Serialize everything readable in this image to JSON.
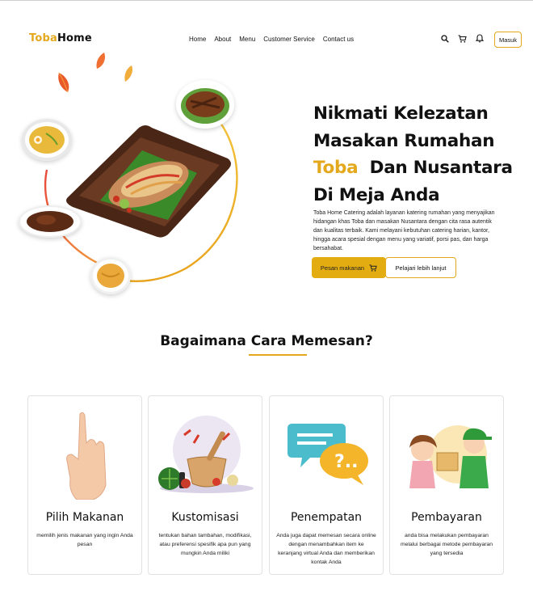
{
  "brand": {
    "part1": "Toba",
    "part2": "Home"
  },
  "nav": {
    "items": [
      "Home",
      "About",
      "Menu",
      "Customer Service",
      "Contact us"
    ]
  },
  "header": {
    "icons": [
      "search-icon",
      "cart-icon",
      "bell-icon"
    ],
    "login_label": "Masuk"
  },
  "hero": {
    "line1": "Nikmati Kelezatan",
    "line2": "Masakan Rumahan",
    "line3_highlight": "Toba",
    "line3_rest": "Dan Nusantara",
    "line4": "Di Meja Anda",
    "description": "Toba Home Catering adalah layanan katering rumahan yang menyajikan hidangan khas Toba dan masakan Nusantara dengan cita rasa autentik dan kualitas terbaik. Kami melayani kebutuhan catering harian, kantor, hingga acara spesial dengan menu yang variatif, porsi pas, dan harga bersahabat.",
    "order_button": "Pesan makanan",
    "learn_button": "Pelajari lebih lanjut"
  },
  "how_to": {
    "title": "Bagaimana Cara Memesan?",
    "steps": [
      {
        "title": "Pilih Makanan",
        "desc": "memilih jenis makanan yang ingin Anda pesan"
      },
      {
        "title": "Kustomisasi",
        "desc": "tentukan bahan tambahan, modifikasi, atau preferensi spesifik apa pun yang mungkin Anda miliki"
      },
      {
        "title": "Penempatan",
        "desc": "Anda juga dapat memesan secara online dengan menambahkan item ke keranjang virtual Anda dan memberikan kontak Anda"
      },
      {
        "title": "Pembayaran",
        "desc": "anda bisa melakukan pembayaran melalui berbagai metode pembayaran yang tersedia"
      }
    ]
  },
  "colors": {
    "accent": "#e3a81b",
    "text": "#111111"
  }
}
